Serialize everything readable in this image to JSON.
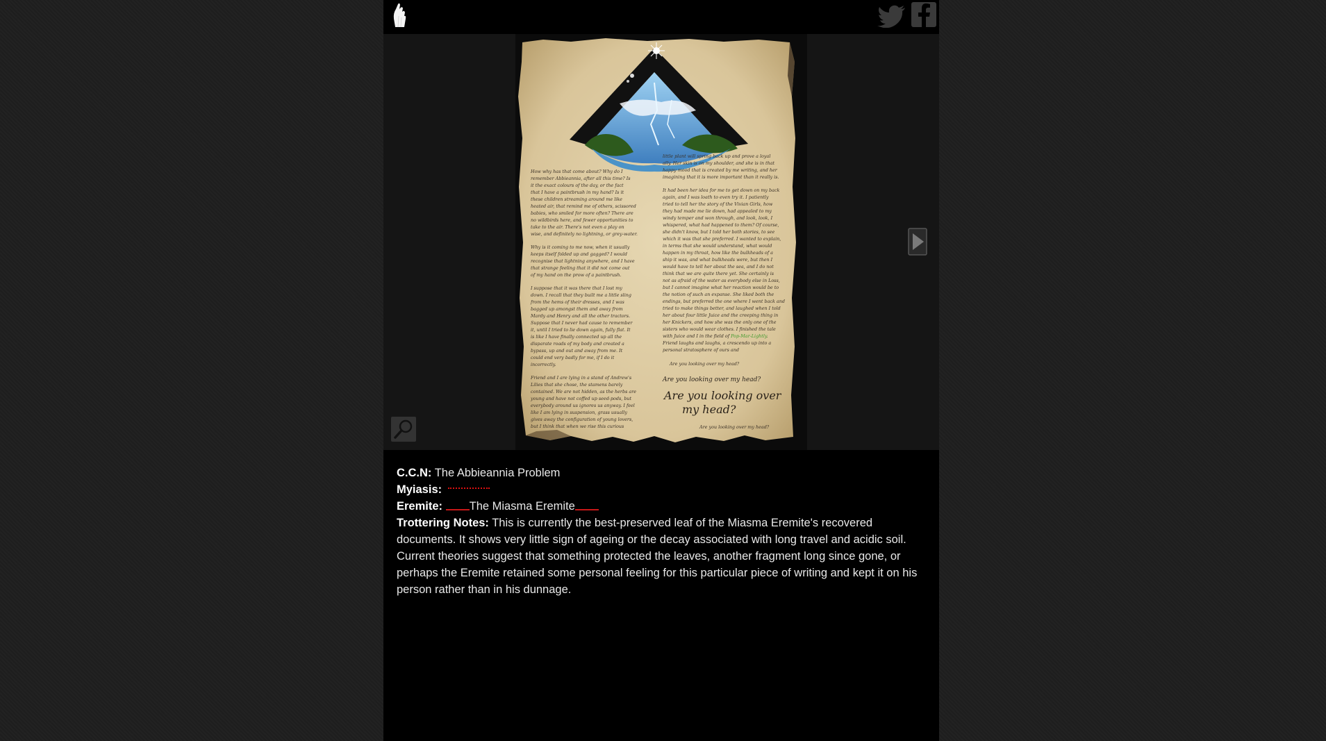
{
  "header": {
    "logo_icon": "white-hand-logo-icon",
    "twitter_icon": "twitter-bird-icon",
    "facebook_icon": "facebook-icon"
  },
  "viewer": {
    "next_icon": "triangle-right-arrow-icon",
    "zoom_icon": "magnifier-icon"
  },
  "leaf": {
    "col1_paragraphs": [
      "How why has that come about? Why do I remember Abbieannia, after all this time? Is it the exact colours of the day, or the fact that I have a paintbrush in my hand? Is it these children streaming around me like heated air, that remind me of others, scissored babies, who smiled for more often? There are no wildbirds here, and fewer opportunities to take to the air. There's not even a play on wise, and definitely no lightning, or grey-water.",
      "Why is it coming to me now, when it usually keeps itself folded up and gagged? I would recognise that lightning anywhere, and I have that strange feeling that it did not come out of my hand on the prow of a paintbrush.",
      "I suppose that it was there that I lost my down. I recall that they built me a little sling from the hems of their dresses, and I was bagged up amongst them and away from Mardy and Henry and all the other tractors. Suppose that I never had cause to remember it, until I tried to lie down again, fully flat. It is like I have finally connected up all the disparate roads of my body and created a bypass, up and out and away from me. It could end very badly for me, if I do it incorrectly.",
      "Friend and I are lying in a stand of Andrew's Lilies that she chose, the stamens barely contained. We are not hidden, as the herbs are young and have not coffed up seed-pods, but everybody around us ignores us anyway. I feel like I am lying in suspension, grass usually gives away the configuration of young lovers, but I think that when we rise this curious"
    ],
    "col2_paragraphs": [
      "little plant will spring back up and prove a loyal ally. Her skin is on my shoulder, and she is in that happy mood that is created by me writing, and her imagining that it is more important than it really is.",
      "It had been her idea for me to get down on my back again, and I was loath to even try it. I patiently tried to tell her the story of the Vivian Girls, how they had made me lie down, had appealed to my windy temper and won through, and look, look, I whispered, what had happened to them? Of course, she didn't know, but I told her both stories, to see which it was that she preferred. I wanted to explain, in terms that she would understand, what would happen in my throat, how like the bulkheads of a ship it was, and what bulkheads were, but then I would have to tell her about the sea, and I do not think that we are quite there yet. She certainly is not as afraid of the water as everybody else in Loss, but I cannot imagine what her reaction would be to the notion of such an expanse. She liked both the endings, but preferred the one where I went back and tried to make things better, and laughed when I told her about four little Juice and the creeping thing in her Knickers, and how she was the only one of the sisters who would wear clothes. I finished the tale with Juice and I in the field of Pop-Mar-Lightly. Friend laughs and laughs, a crescendo up into a personal stratosphere of ours and"
    ],
    "question_small": "Are you looking over my head?",
    "question_medium": "Are you looking over my head?",
    "question_large_line1": "Are you looking over",
    "question_large_line2": "my head?",
    "question_footer": "Are you looking over my head?"
  },
  "caption": {
    "ccn_label": "C.C.N:",
    "ccn_value": "The Abbieannia Problem",
    "myiasis_label": "Myiasis:",
    "eremite_label": "Eremite:",
    "eremite_value": "The Miasma Eremite",
    "notes_label": "Trottering Notes:",
    "notes_value": "This is currently the best-preserved leaf of the Miasma Eremite's recovered documents. It shows very little sign of ageing or the decay associated with long travel and acidic soil. Current theories suggest that something protected the leaves, another fragment long since gone, or perhaps the Eremite retained some personal feeling for this particular piece of writing and kept it on his person rather than in his dunnage."
  },
  "colors": {
    "page_bg": "#1f1f1f",
    "panel_bg": "#000000",
    "viewer_bg": "#151515",
    "parchment": "#e2d3ad",
    "ink": "#3a3026",
    "green_ink": "#3e9a2c",
    "red_mark": "#d01818"
  }
}
